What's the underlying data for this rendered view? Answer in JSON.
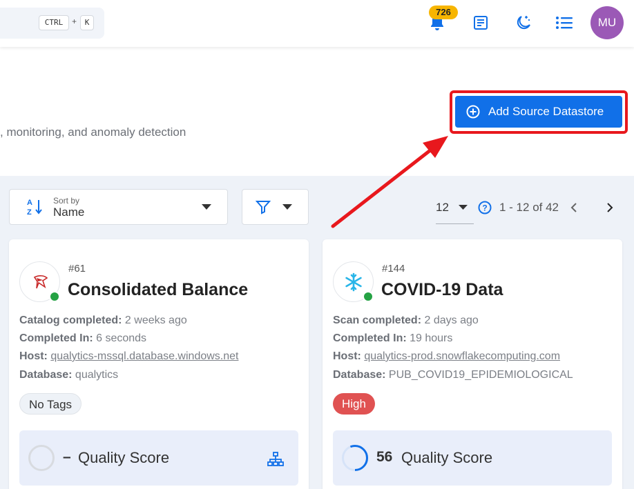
{
  "topbar": {
    "shortcut_key1": "CTRL",
    "shortcut_plus": "+",
    "shortcut_key2": "K",
    "notification_count": "726",
    "avatar_initials": "MU"
  },
  "header": {
    "subtitle": ", monitoring, and anomaly detection",
    "add_button_label": "Add Source Datastore"
  },
  "toolbar": {
    "sort_label": "Sort by",
    "sort_value": "Name",
    "per_page": "12",
    "range_text": "1 - 12 of 42"
  },
  "cards": [
    {
      "id": "#61",
      "title": "Consolidated Balance",
      "line1_key": "Catalog completed:",
      "line1_val": " 2 weeks ago",
      "line2_key": "Completed In:",
      "line2_val": " 6 seconds",
      "host_key": "Host:",
      "host_val": "qualytics-mssql.database.windows.net",
      "db_key": "Database:",
      "db_val": " qualytics",
      "tag": "No Tags",
      "score_value": "–",
      "score_label": "Quality Score"
    },
    {
      "id": "#144",
      "title": "COVID-19 Data",
      "line1_key": "Scan completed:",
      "line1_val": " 2 days ago",
      "line2_key": "Completed In:",
      "line2_val": " 19 hours",
      "host_key": "Host:",
      "host_val": "qualytics-prod.snowflakecomputing.com",
      "db_key": "Database:",
      "db_val": " PUB_COVID19_EPIDEMIOLOGICAL",
      "tag": "High",
      "score_value": "56",
      "score_label": "Quality Score"
    }
  ],
  "colors": {
    "primary": "#1170e8",
    "highlight": "#e8181d",
    "badge": "#f7b500",
    "avatar": "#9b59b6",
    "status_ok": "#25a244",
    "tag_high": "#e05252"
  }
}
